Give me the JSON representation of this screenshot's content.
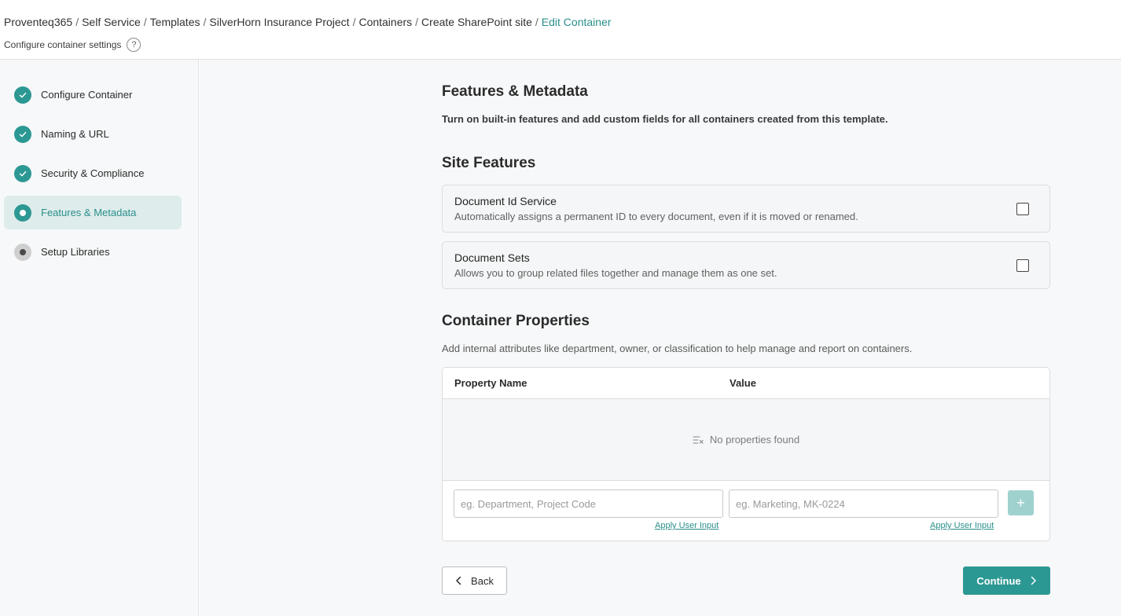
{
  "breadcrumb": {
    "items": [
      "Proventeq365",
      "Self Service",
      "Templates",
      "SilverHorn Insurance Project",
      "Containers",
      "Create SharePoint site"
    ],
    "current": "Edit Container"
  },
  "header": {
    "subtitle": "Configure container settings",
    "help_label": "?"
  },
  "sidebar": {
    "steps": [
      {
        "label": "Configure Container",
        "state": "done",
        "icon": "check-icon"
      },
      {
        "label": "Naming & URL",
        "state": "done",
        "icon": "check-icon"
      },
      {
        "label": "Security & Compliance",
        "state": "done",
        "icon": "check-icon"
      },
      {
        "label": "Features & Metadata",
        "state": "current",
        "icon": "current-dot-icon"
      },
      {
        "label": "Setup Libraries",
        "state": "pending",
        "icon": "pending-dot-icon"
      }
    ]
  },
  "main": {
    "title": "Features & Metadata",
    "description": "Turn on built-in features and add custom fields for all containers created from this template.",
    "site_features": {
      "heading": "Site Features",
      "items": [
        {
          "title": "Document Id Service",
          "description": "Automatically assigns a permanent ID to every document, even if it is moved or renamed.",
          "checked": false
        },
        {
          "title": "Document Sets",
          "description": "Allows you to group related files together and manage them as one set.",
          "checked": false
        }
      ]
    },
    "container_properties": {
      "heading": "Container Properties",
      "description": "Add internal attributes like department, owner, or classification to help manage and report on containers.",
      "columns": [
        "Property Name",
        "Value"
      ],
      "empty_text": "No properties found",
      "name_placeholder": "eg. Department, Project Code",
      "value_placeholder": "eg. Marketing, MK-0224",
      "apply_label": "Apply User Input",
      "add_label": "+"
    },
    "back_label": "Back",
    "continue_label": "Continue"
  },
  "colors": {
    "accent": "#2c9893",
    "accent_light": "#9fd2cf",
    "active_bg": "#deecec"
  }
}
